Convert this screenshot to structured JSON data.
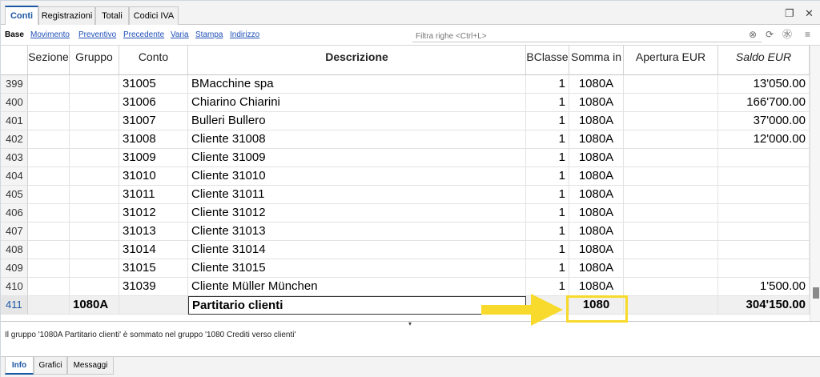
{
  "tabs": [
    "Conti",
    "Registrazioni",
    "Totali",
    "Codici IVA"
  ],
  "window_icons": {
    "restore": "❐",
    "close": "✕"
  },
  "views": [
    "Base",
    "Movimento",
    "Preventivo",
    "Precedente",
    "Varia",
    "Stampa",
    "Indirizzo"
  ],
  "filter": {
    "placeholder": "Filtra righe <Ctrl+L>"
  },
  "toolbar_icons": {
    "clear": "⊗",
    "refresh": "⟳",
    "translate": "㊌",
    "menu": "≡"
  },
  "columns": [
    "",
    "Sezione",
    "Gruppo",
    "Conto",
    "Descrizione",
    "BClasse",
    "Somma in",
    "Apertura EUR",
    "Saldo EUR"
  ],
  "rows": [
    {
      "num": "399",
      "sezione": "",
      "gruppo": "",
      "conto": "31005",
      "descrizione": "BMacchine spa",
      "bclasse": "1",
      "somma": "1080A",
      "apertura": "",
      "saldo": "13'050.00"
    },
    {
      "num": "400",
      "sezione": "",
      "gruppo": "",
      "conto": "31006",
      "descrizione": "Chiarino Chiarini",
      "bclasse": "1",
      "somma": "1080A",
      "apertura": "",
      "saldo": "166'700.00"
    },
    {
      "num": "401",
      "sezione": "",
      "gruppo": "",
      "conto": "31007",
      "descrizione": "Bulleri Bullero",
      "bclasse": "1",
      "somma": "1080A",
      "apertura": "",
      "saldo": "37'000.00"
    },
    {
      "num": "402",
      "sezione": "",
      "gruppo": "",
      "conto": "31008",
      "descrizione": "Cliente 31008",
      "bclasse": "1",
      "somma": "1080A",
      "apertura": "",
      "saldo": "12'000.00"
    },
    {
      "num": "403",
      "sezione": "",
      "gruppo": "",
      "conto": "31009",
      "descrizione": "Cliente 31009",
      "bclasse": "1",
      "somma": "1080A",
      "apertura": "",
      "saldo": ""
    },
    {
      "num": "404",
      "sezione": "",
      "gruppo": "",
      "conto": "31010",
      "descrizione": "Cliente 31010",
      "bclasse": "1",
      "somma": "1080A",
      "apertura": "",
      "saldo": ""
    },
    {
      "num": "405",
      "sezione": "",
      "gruppo": "",
      "conto": "31011",
      "descrizione": "Cliente 31011",
      "bclasse": "1",
      "somma": "1080A",
      "apertura": "",
      "saldo": ""
    },
    {
      "num": "406",
      "sezione": "",
      "gruppo": "",
      "conto": "31012",
      "descrizione": "Cliente 31012",
      "bclasse": "1",
      "somma": "1080A",
      "apertura": "",
      "saldo": ""
    },
    {
      "num": "407",
      "sezione": "",
      "gruppo": "",
      "conto": "31013",
      "descrizione": "Cliente 31013",
      "bclasse": "1",
      "somma": "1080A",
      "apertura": "",
      "saldo": ""
    },
    {
      "num": "408",
      "sezione": "",
      "gruppo": "",
      "conto": "31014",
      "descrizione": "Cliente 31014",
      "bclasse": "1",
      "somma": "1080A",
      "apertura": "",
      "saldo": ""
    },
    {
      "num": "409",
      "sezione": "",
      "gruppo": "",
      "conto": "31015",
      "descrizione": "Cliente 31015",
      "bclasse": "1",
      "somma": "1080A",
      "apertura": "",
      "saldo": ""
    },
    {
      "num": "410",
      "sezione": "",
      "gruppo": "",
      "conto": "31039",
      "descrizione": "Cliente Müller München",
      "bclasse": "1",
      "somma": "1080A",
      "apertura": "",
      "saldo": "1'500.00"
    },
    {
      "num": "411",
      "sezione": "",
      "gruppo": "1080A",
      "conto": "",
      "descrizione": "Partitario clienti",
      "bclasse": "",
      "somma": "1080",
      "apertura": "",
      "saldo": "304'150.00",
      "total": true
    }
  ],
  "info": {
    "splitter": "▾",
    "message": "Il gruppo '1080A Partitario clienti' è sommato nel gruppo '1080 Crediti verso clienti'"
  },
  "bottom_tabs": [
    "Info",
    "Grafici",
    "Messaggi"
  ],
  "annotation": {
    "arrow_color": "#f7da2b",
    "highlight_color": "#f7da2b"
  }
}
